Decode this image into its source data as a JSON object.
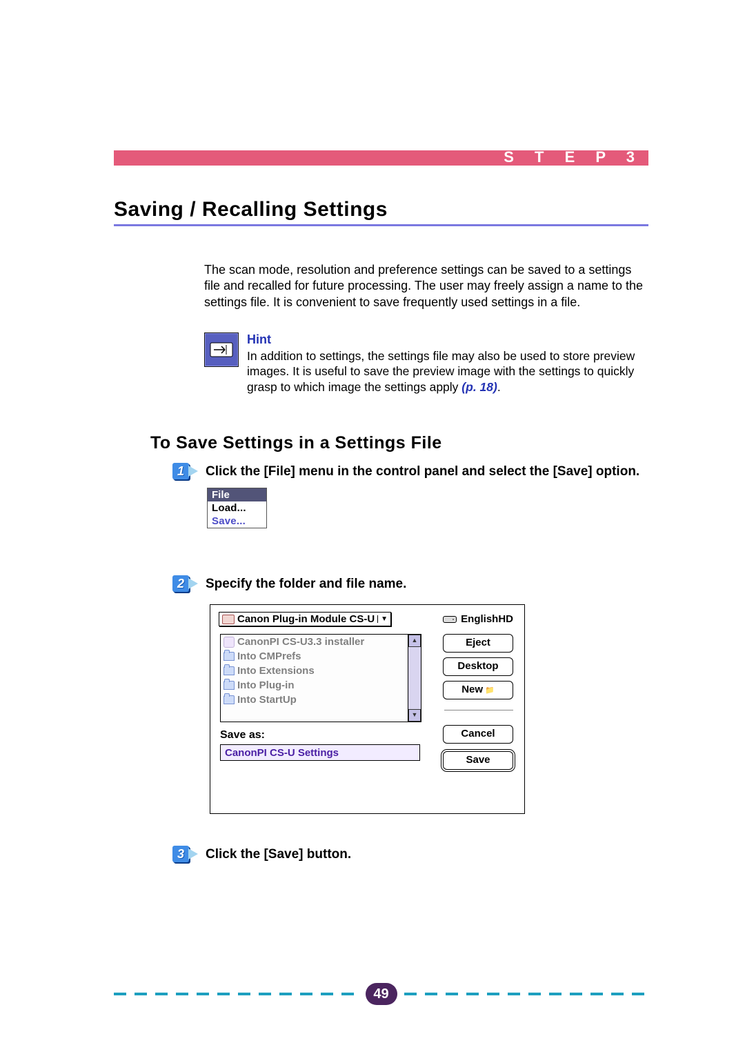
{
  "header": {
    "step_label": "S T E P   3"
  },
  "title": "Saving / Recalling Settings",
  "intro": "The scan mode, resolution and preference settings can be saved to a settings file and recalled for future processing. The user may freely assign a name to the settings file. It is convenient to save frequently used settings in a file.",
  "hint": {
    "heading": "Hint",
    "body_before": "In addition to settings, the settings file may also be used to store preview images. It is useful to save the preview image with the settings to quickly grasp to which image the settings apply ",
    "page_ref": "(p. 18)",
    "body_after": "."
  },
  "subheading": "To Save Settings in a Settings File",
  "steps": {
    "1": "Click the [File] menu in the control panel and select the [Save] option.",
    "2": "Specify the folder and file name.",
    "3": "Click the [Save] button."
  },
  "file_menu": {
    "title": "File",
    "items": [
      "Load...",
      "Save..."
    ]
  },
  "save_dialog": {
    "folder_dropdown": "Canon Plug-in Module CS-U",
    "drive": "EnglishHD",
    "list": [
      "CanonPI CS-U3.3 installer",
      "Into CMPrefs",
      "Into Extensions",
      "Into Plug-in",
      "Into StartUp"
    ],
    "save_as_label": "Save as:",
    "save_as_value": "CanonPI CS-U Settings",
    "buttons": {
      "eject": "Eject",
      "desktop": "Desktop",
      "new": "New",
      "cancel": "Cancel",
      "save": "Save"
    }
  },
  "page_number": "49"
}
